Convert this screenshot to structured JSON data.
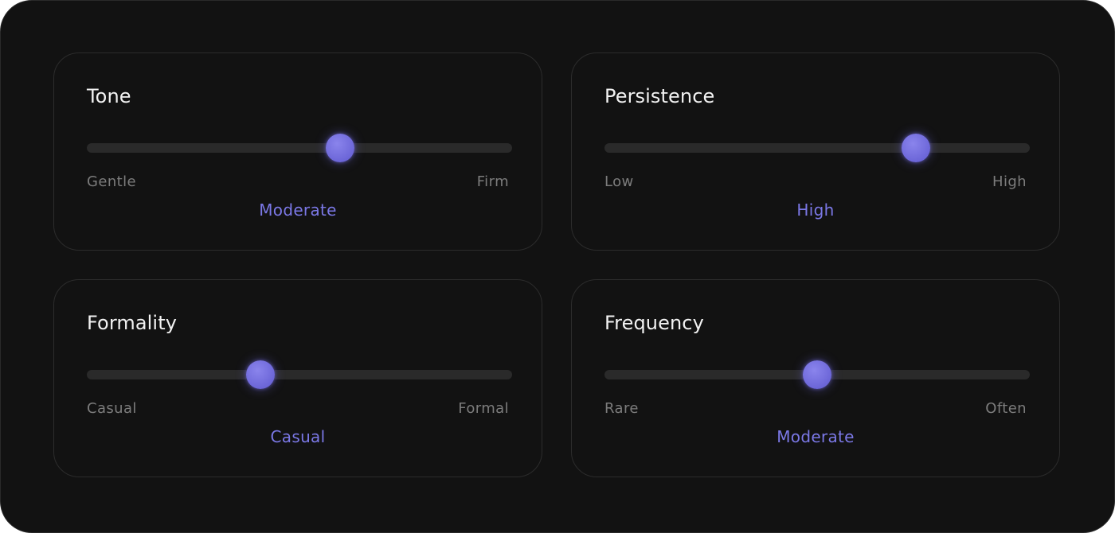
{
  "accent_color": "#7b78e6",
  "cards": [
    {
      "title": "Tone",
      "min_label": "Gentle",
      "max_label": "Firm",
      "value_label": "Moderate",
      "level": 0.595
    },
    {
      "title": "Persistence",
      "min_label": "Low",
      "max_label": "High",
      "value_label": "High",
      "level": 0.733
    },
    {
      "title": "Formality",
      "min_label": "Casual",
      "max_label": "Formal",
      "value_label": "Casual",
      "level": 0.408
    },
    {
      "title": "Frequency",
      "min_label": "Rare",
      "max_label": "Often",
      "value_label": "Moderate",
      "level": 0.5
    }
  ]
}
